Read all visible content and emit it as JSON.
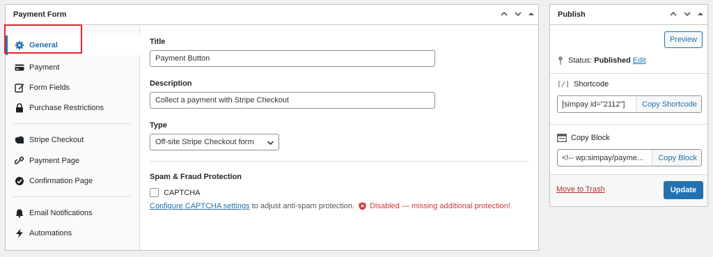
{
  "payment_form": {
    "title": "Payment Form",
    "tabs": [
      {
        "label": "General",
        "icon": "gear-icon",
        "active": true
      },
      {
        "label": "Payment",
        "icon": "credit-card-icon"
      },
      {
        "label": "Form Fields",
        "icon": "edit-icon"
      },
      {
        "label": "Purchase Restrictions",
        "icon": "lock-icon"
      },
      {
        "label": "Stripe Checkout",
        "icon": "stripe-checkout-icon"
      },
      {
        "label": "Payment Page",
        "icon": "link-icon"
      },
      {
        "label": "Confirmation Page",
        "icon": "check-circle-icon"
      },
      {
        "label": "Email Notifications",
        "icon": "bell-icon"
      },
      {
        "label": "Automations",
        "icon": "lightning-icon"
      }
    ],
    "fields": {
      "title_label": "Title",
      "title_value": "Payment Button",
      "description_label": "Description",
      "description_value": "Collect a payment with Stripe Checkout",
      "type_label": "Type",
      "type_value": "Off-site Stripe Checkout form",
      "spam_label": "Spam & Fraud Protection",
      "captcha_label": "CAPTCHA",
      "captcha_checked": false,
      "configure_link": "Configure CAPTCHA settings",
      "configure_suffix": " to adjust anti-spam protection.",
      "warning": "Disabled — missing additional protection!"
    }
  },
  "publish": {
    "title": "Publish",
    "preview_label": "Preview",
    "status_prefix": "Status:",
    "status_value": "Published",
    "status_edit": "Edit",
    "shortcode_label": "Shortcode",
    "shortcode_value": "[simpay id=\"2112\"]",
    "copy_shortcode_label": "Copy Shortcode",
    "copy_block_label": "Copy Block",
    "block_value": "<!-- wp:simpay/payme...",
    "copy_block_button": "Copy Block",
    "trash_label": "Move to Trash",
    "update_label": "Update"
  },
  "colors": {
    "accent": "#2271b1",
    "warning": "#d63638",
    "highlight": "#e8222a"
  }
}
